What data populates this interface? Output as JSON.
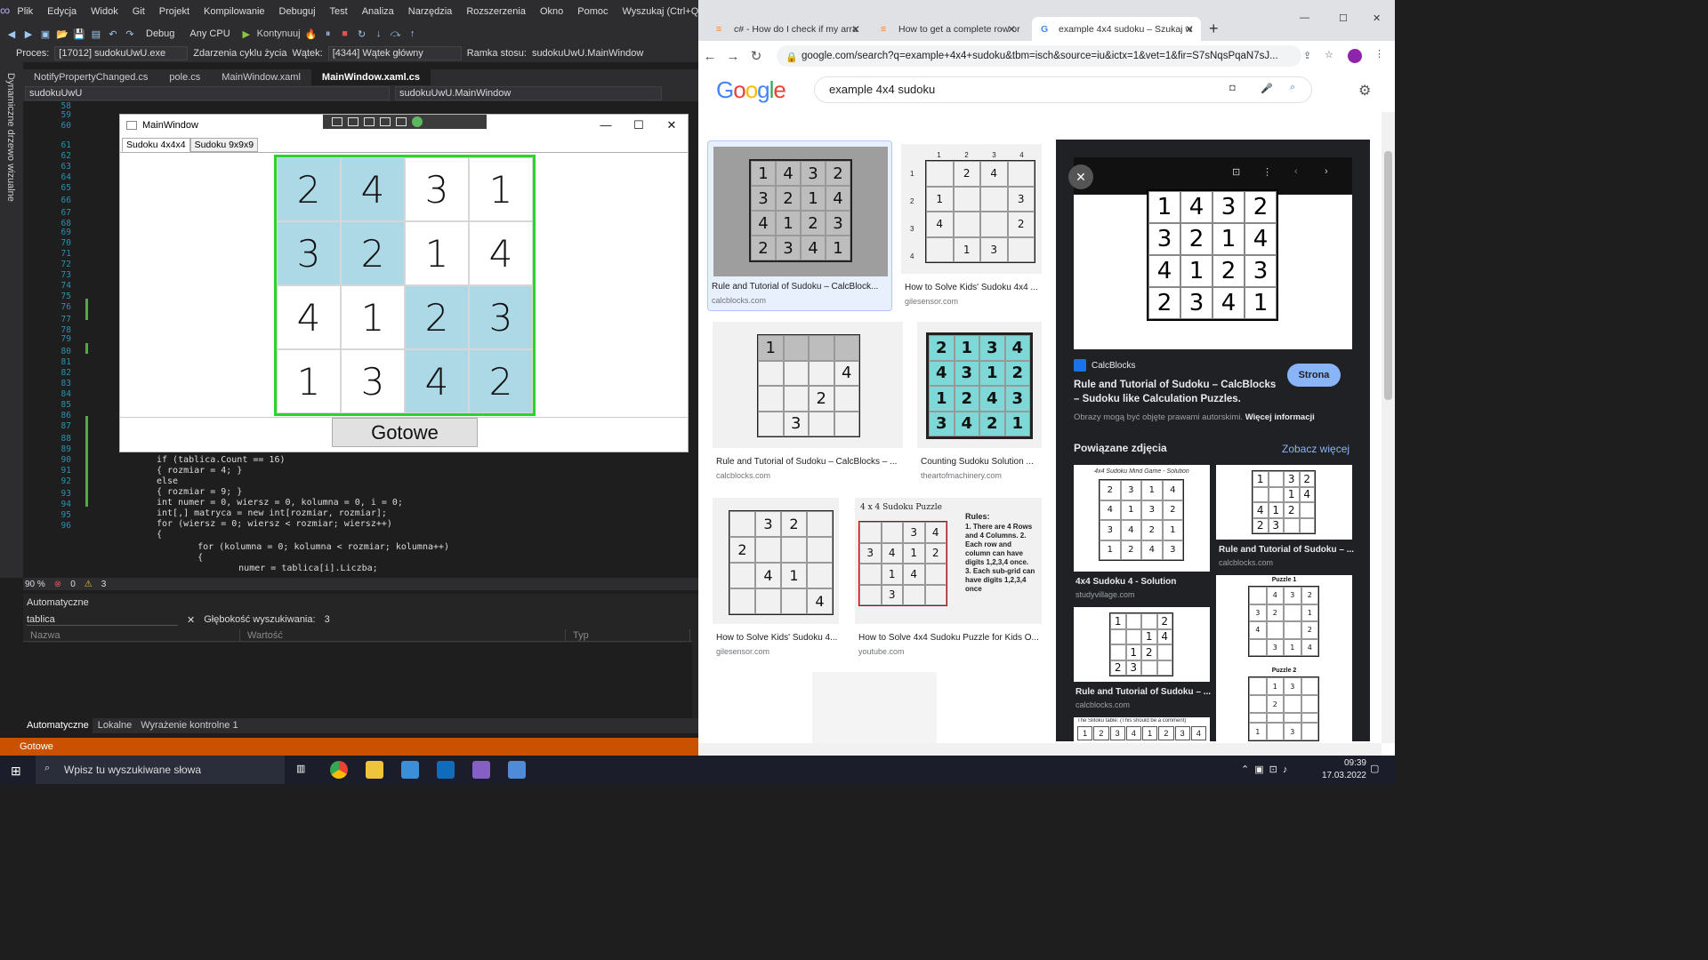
{
  "vs": {
    "menu": [
      "Plik",
      "Edycja",
      "Widok",
      "Git",
      "Projekt",
      "Kompilowanie",
      "Debuguj",
      "Test",
      "Analiza",
      "Narzędzia",
      "Rozszerzenia",
      "Okno",
      "Pomoc",
      "Wyszukaj (Ctrl+Q)"
    ],
    "toolbar": {
      "config": "Debug",
      "platform": "Any CPU",
      "continue": "Kontynuuj"
    },
    "process_bar": {
      "proces_label": "Proces:",
      "proces_value": "[17012] sudokuUwU.exe",
      "events": "Zdarzenia cyklu życia",
      "watek_label": "Wątek:",
      "watek_value": "[4344] Wątek główny",
      "ramka_label": "Ramka stosu:",
      "ramka_value": "sudokuUwU.MainWindow"
    },
    "side_label": "Dynamiczne drzewo wizualne",
    "tabs": [
      "NotifyPropertyChanged.cs",
      "pole.cs",
      "MainWindow.xaml",
      "MainWindow.xaml.cs"
    ],
    "nav": {
      "project": "sudokuUwU",
      "class": "sudokuUwU.MainWindow"
    },
    "line_numbers": [
      "58",
      "59",
      "60",
      "61",
      "62",
      "63",
      "64",
      "65",
      "66",
      "67",
      "68",
      "69",
      "70",
      "71",
      "72",
      "73",
      "74",
      "75",
      "76",
      "77",
      "78",
      "79",
      "80",
      "81",
      "82",
      "83",
      "84",
      "85",
      "86",
      "87",
      "88",
      "89",
      "90",
      "91",
      "92",
      "93",
      "94",
      "95",
      "96"
    ],
    "code_lines": [
      "if (tablica.Count == 16)",
      "{ rozmiar = 4; }",
      "else",
      "{ rozmiar = 9; }",
      "int numer = 0, wiersz = 0, kolumna = 0, i = 0;",
      "int[,] matryca = new int[rozmiar, rozmiar];",
      "for (wiersz = 0; wiersz < rozmiar; wiersz++)",
      "{",
      "    for (kolumna = 0; kolumna < rozmiar; kolumna++)",
      "    {",
      "        numer = tablica[i].Liczba;"
    ],
    "editor_status": {
      "zoom": "90 %",
      "errors": "0",
      "warnings": "3"
    },
    "autos": {
      "title": "Automatyczne",
      "search_value": "tablica",
      "depth_label": "Głębokość wyszukiwania:",
      "depth_value": "3",
      "columns": [
        "Nazwa",
        "Wartość",
        "Typ"
      ]
    },
    "bottom_tabs": [
      "Automatyczne",
      "Lokalne",
      "Wyrażenie kontrolne 1"
    ],
    "status": "Gotowe"
  },
  "wpf": {
    "title": "MainWindow",
    "tabs": [
      "Sudoku 4x4x4",
      "Sudoku 9x9x9"
    ],
    "grid": [
      [
        {
          "v": "2",
          "blue": true
        },
        {
          "v": "4",
          "blue": true
        },
        {
          "v": "3",
          "blue": false
        },
        {
          "v": "1",
          "blue": false
        }
      ],
      [
        {
          "v": "3",
          "blue": true
        },
        {
          "v": "2",
          "blue": true
        },
        {
          "v": "1",
          "blue": false
        },
        {
          "v": "4",
          "blue": false
        }
      ],
      [
        {
          "v": "4",
          "blue": false
        },
        {
          "v": "1",
          "blue": false
        },
        {
          "v": "2",
          "blue": true
        },
        {
          "v": "3",
          "blue": true
        }
      ],
      [
        {
          "v": "1",
          "blue": false
        },
        {
          "v": "3",
          "blue": false
        },
        {
          "v": "4",
          "blue": true
        },
        {
          "v": "2",
          "blue": true
        }
      ]
    ],
    "button": "Gotowe",
    "colors": {
      "border": "#2bd42b",
      "cell_highlight": "#add8e6"
    }
  },
  "chrome": {
    "tabs": [
      "c# - How do I check if my arra",
      "How to get a complete row or",
      "example 4x4 sudoku – Szukaj w"
    ],
    "url": "google.com/search?q=example+4x4+sudoku&tbm=isch&source=iu&ictx=1&vet=1&fir=S7sNqsPqaN7sJ...",
    "query": "example 4x4 sudoku",
    "results": [
      {
        "caption": "Rule and Tutorial of Sudoku – CalcBlock...",
        "source": "calcblocks.com"
      },
      {
        "caption": "How to Solve Kids' Sudoku 4x4 ...",
        "source": "gilesensor.com"
      },
      {
        "caption": "Rule and Tutorial of Sudoku – CalcBlocks – ...",
        "source": "calcblocks.com"
      },
      {
        "caption": "Counting Sudoku Solution ...",
        "source": "theartofmachinery.com"
      },
      {
        "caption": "How to Solve Kids' Sudoku 4...",
        "source": "gilesensor.com"
      },
      {
        "caption": "How to Solve 4x4 Sudoku Puzzle for Kids O...",
        "source": "youtube.com"
      }
    ],
    "thumb_grids": {
      "calc": [
        "1",
        "4",
        "3",
        "2",
        "3",
        "2",
        "1",
        "4",
        "4",
        "1",
        "2",
        "3",
        "2",
        "3",
        "4",
        "1"
      ],
      "giles": [
        "",
        "2",
        "4",
        "",
        "1",
        "",
        "",
        "3",
        "4",
        "",
        "",
        "2",
        "",
        "1",
        "3",
        ""
      ],
      "calc2": [
        "1",
        "",
        "",
        "",
        "",
        "",
        "",
        "4",
        "",
        "",
        "2",
        "",
        "",
        "3",
        "",
        ""
      ],
      "art": [
        "2",
        "1",
        "3",
        "4",
        "4",
        "3",
        "1",
        "2",
        "1",
        "2",
        "4",
        "3",
        "3",
        "4",
        "2",
        "1"
      ],
      "giles2": [
        "",
        "3",
        "2",
        "",
        "2",
        "",
        "",
        "",
        "",
        "4",
        "1",
        "",
        "",
        "",
        "",
        "4"
      ],
      "yt": [
        "",
        "",
        "3",
        "4",
        "3",
        "4",
        "1",
        "2",
        "",
        "1",
        "4",
        "",
        "",
        "3",
        "",
        ""
      ]
    },
    "giles_axis": [
      "1",
      "2",
      "3",
      "4"
    ],
    "yt_title": "4 x 4 Sudoku Puzzle",
    "yt_rules_title": "Rules:",
    "yt_rules": "1. There are 4 Rows and 4 Columns. 2. Each row and column can have digits 1,2,3,4 once. 3. Each sub-grid can have digits 1,2,3,4 once",
    "panel": {
      "site": "CalcBlocks",
      "title": "Rule and Tutorial of Sudoku – CalcBlocks – Sudoku like Calculation Puzzles.",
      "visit": "Strona",
      "copyright": "Obrazy mogą być objęte prawami autorskimi.",
      "more_info": "Więcej informacji",
      "related": "Powiązane zdjęcia",
      "see_more": "Zobacz więcej",
      "grid": [
        "1",
        "4",
        "3",
        "2",
        "3",
        "2",
        "1",
        "4",
        "4",
        "1",
        "2",
        "3",
        "2",
        "3",
        "4",
        "1"
      ],
      "related_items": [
        {
          "caption": "4x4 Sudoku 4 - Solution",
          "source": "studyvillage.com"
        },
        {
          "caption": "Rule and Tutorial of Sudoku – ...",
          "source": "calcblocks.com"
        },
        {
          "caption": "Rule and Tutorial of Sudoku – ...",
          "source": "calcblocks.com"
        }
      ],
      "related_grids": {
        "study_title": "4x4 Sudoku Mind Game - Solution",
        "study": [
          "2",
          "3",
          "1",
          "4",
          "4",
          "1",
          "3",
          "2",
          "3",
          "4",
          "2",
          "1",
          "1",
          "2",
          "4",
          "3"
        ],
        "calc_a": [
          "1",
          "",
          "3",
          "2",
          "",
          "",
          "1",
          "4",
          "4",
          "1",
          "2",
          "",
          "2",
          "3",
          "",
          ""
        ],
        "calc_b": [
          "1",
          "",
          "",
          "2",
          "",
          "",
          "1",
          "4",
          "",
          "1",
          "2",
          "",
          "2",
          "3",
          "",
          ""
        ],
        "puzzle1_title": "Puzzle 1",
        "puzzle2_title": "Puzzle 2",
        "puzzle1": [
          "",
          "4",
          "3",
          "2",
          "3",
          "2",
          "",
          "1",
          "4",
          "",
          "",
          "2",
          "",
          "3",
          "1",
          "4"
        ],
        "puzzle2": [
          "",
          "1",
          "3",
          "",
          "",
          "2",
          "",
          "",
          "",
          "",
          "",
          "",
          "1",
          "",
          "3",
          ""
        ],
        "slitoku": "The Slitoku table: (This should be a comment)",
        "slitoku_row": [
          "1",
          "2",
          "3",
          "4",
          "1",
          "2",
          "3",
          "4"
        ]
      }
    }
  },
  "taskbar": {
    "search_placeholder": "Wpisz tu wyszukiwane słowa",
    "time": "09:39",
    "date": "17.03.2022"
  }
}
